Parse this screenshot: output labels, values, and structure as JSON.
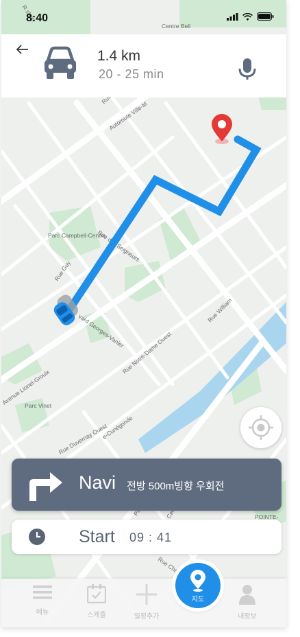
{
  "status_bar": {
    "time": "8:40"
  },
  "header": {
    "distance": "1.4 km",
    "duration": "20 - 25 min"
  },
  "map": {
    "labels": {
      "centre_bell": "Centre Bell",
      "autoroute": "Autoroute Ville-M",
      "parc_campbell": "Parc Campbell-Centre",
      "rue_des_seigneurs": "Rue des Seigneurs",
      "rue_guy": "Rue Guy",
      "rue_william": "Rue William",
      "rue_notre_dame": "Rue Notre-Dame Ouest",
      "georges_vanier": "vard Georges-Vanier",
      "avenue_lionel": "Avenue Lionel-Groulx",
      "parc_vinet": "Parc Vinet",
      "rue_duvernay": "Rue Duvernay Ouest",
      "rue_st_cunegonde": "e-Cunégonde",
      "pointe": "POINTE-",
      "rue_charle": "Rue Charle",
      "rue_top": "Rue",
      "rue_pau": "Pau",
      "rue_cent": "Cent",
      "ar": "AR",
      "rue_shop": "R shop"
    }
  },
  "navi": {
    "word": "Navi",
    "instruction": "전방 500m빙향 우회전"
  },
  "start": {
    "word": "Start",
    "time": "09 : 41"
  },
  "tabs": [
    {
      "label": "메뉴",
      "icon": "menu-icon"
    },
    {
      "label": "스케줄",
      "icon": "calendar-icon"
    },
    {
      "label": "일정추가",
      "icon": "plus-icon"
    },
    {
      "label": "지도",
      "icon": "map-pin-icon"
    },
    {
      "label": "내정보",
      "icon": "person-icon"
    }
  ],
  "colors": {
    "route": "#1f8fe8",
    "navi_bg": "#5f6c80",
    "pin": "#e53935",
    "fab": "#1f8fe8"
  }
}
